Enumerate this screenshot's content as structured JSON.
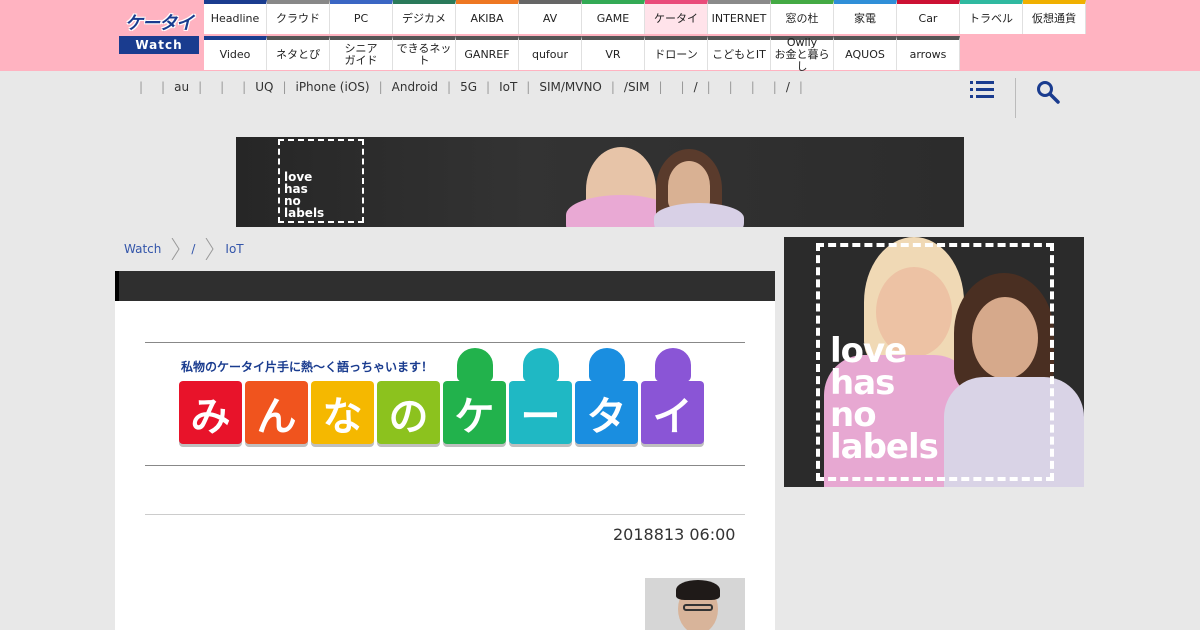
{
  "logo": {
    "top": "ケータイ",
    "bottom": "Watch"
  },
  "nav": {
    "row1": [
      "Headline",
      "クラウド",
      "PC",
      "デジカメ",
      "AKIBA",
      "AV",
      "GAME",
      "ケータイ",
      "INTERNET",
      "窓の杜",
      "家電",
      "Car",
      "トラベル",
      "仮想通貨"
    ],
    "row2": [
      "Video",
      "ネタとぴ",
      "シニア\nガイド",
      "できるネット",
      "GANREF",
      "qufour",
      "VR",
      "ドローン",
      "こどもとIT",
      "Owlly\nお金と暮らし",
      "AQUOS",
      "arrows"
    ],
    "row1_colors": [
      "#1a3c8f",
      "#888888",
      "#3a66c4",
      "#2a7a5a",
      "#ee7722",
      "#666666",
      "#33aa55",
      "#e94b7a",
      "#8a8a8a",
      "#44aa44",
      "#2f8fd8",
      "#cc1133",
      "#2fb9a0",
      "#f0b000"
    ],
    "row2_colors": [
      "#1a3c8f",
      "#555555",
      "#555555",
      "#555555",
      "#555555",
      "#555555",
      "#555555",
      "#555555",
      "#555555",
      "#555555",
      "#555555",
      "#555555"
    ],
    "active": "ケータイ"
  },
  "subnav": [
    "",
    "au",
    "",
    "",
    "UQ",
    "iPhone (iOS)",
    "Android",
    "5G",
    "IoT",
    "SIM/MVNO",
    "/SIM",
    "",
    "/",
    "",
    "",
    "",
    "/",
    ""
  ],
  "icons": {
    "menu": "menu-icon",
    "search": "search-icon"
  },
  "banner": {
    "tagline": "love\nhas\nno\nlabels"
  },
  "breadcrumb": [
    "Watch",
    "/",
    "IoT"
  ],
  "article": {
    "title": "",
    "series_tagline": "私物のケータイ片手に熱～く語っちゃいます！",
    "series_chars": [
      "み",
      "ん",
      "な",
      "の",
      "ケ",
      "ー",
      "タ",
      "イ"
    ],
    "series_colors": [
      "#e8132a",
      "#f0541e",
      "#f5b800",
      "#8cc21e",
      "#22b24c",
      "#1fb8c4",
      "#1a8ee0",
      "#8a55d6"
    ],
    "date": "2018813 06:00"
  },
  "side_ad": {
    "tagline": "love\nhas\nno\nlabels"
  }
}
